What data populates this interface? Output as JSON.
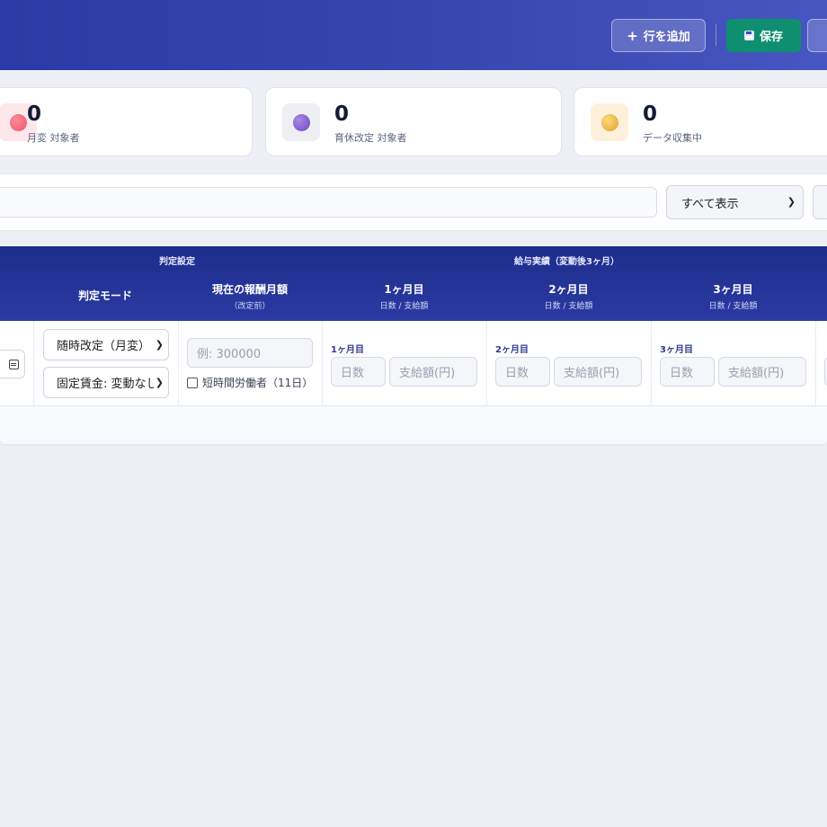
{
  "header": {
    "add_row_icon": "+",
    "add_row_label": "行を追加",
    "save_icon": "floppy-disk-icon",
    "save_label": "保存"
  },
  "stats": [
    {
      "value": "0",
      "label": "月変 対象者",
      "color": "#e8566c",
      "icon": "red-dot-icon"
    },
    {
      "value": "0",
      "label": "育休改定 対象者",
      "color": "#7b55c9",
      "icon": "purple-dot-icon"
    },
    {
      "value": "0",
      "label": "データ収集中",
      "color": "#e8b23a",
      "icon": "yellow-dot-icon"
    }
  ],
  "filter": {
    "search_placeholder": "",
    "display_select": "すべて表示"
  },
  "table": {
    "group_judgement": "判定設定",
    "group_salary": "給与実績（変動後3ヶ月）",
    "col_mode": "判定モード",
    "col_current": "現在の報酬月額",
    "col_current_sub": "（改定前）",
    "months": [
      {
        "title": "1ヶ月目",
        "sub": "日数 / 支給額",
        "label": "1ヶ月目"
      },
      {
        "title": "2ヶ月目",
        "sub": "日数 / 支給額",
        "label": "2ヶ月目"
      },
      {
        "title": "3ヶ月目",
        "sub": "日数 / 支給額",
        "label": "3ヶ月目"
      }
    ],
    "row": {
      "mode_select": "随時改定（月変）",
      "wage_select": "固定賃金: 変動なし",
      "current_placeholder": "例: 300000",
      "short_time_label": "短時間労働者（11日）",
      "days_placeholder": "日数",
      "pay_placeholder": "支給額(円)"
    }
  }
}
